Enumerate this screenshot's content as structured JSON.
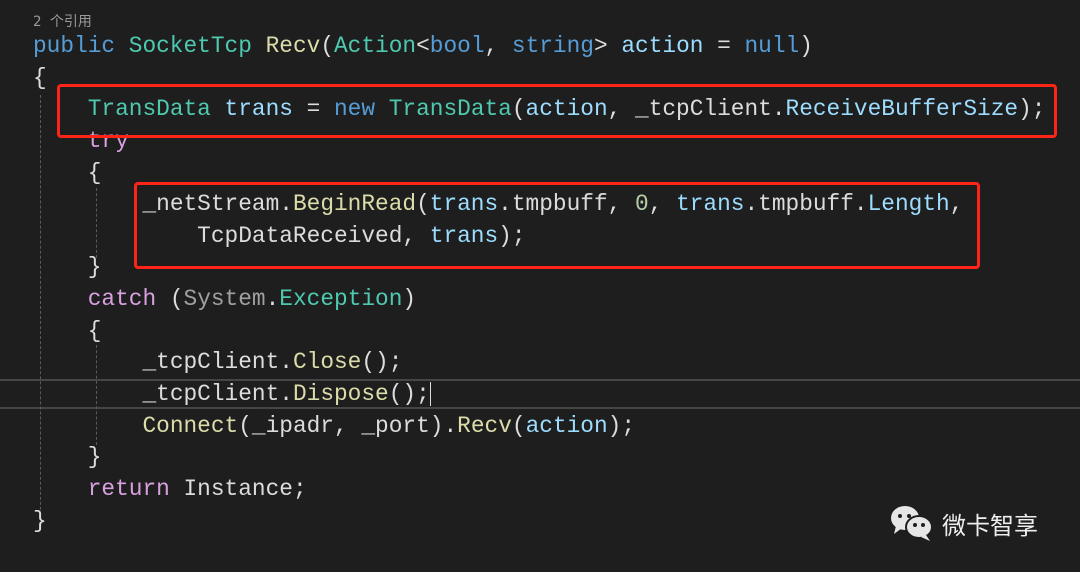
{
  "references": "2 个引用",
  "colors": {
    "kw": "#569cd6",
    "type": "#4ec9b0",
    "method": "#dcdcaa",
    "var": "#9cdcfe",
    "ctrl": "#d8a0df",
    "text": "#dcdcdc",
    "gray": "#a0a0a0",
    "num": "#b5cea8",
    "highlight": "#ff2418"
  },
  "lines": [
    {
      "indent": 0,
      "tokens": [
        [
          "public ",
          "kw"
        ],
        [
          "SocketTcp ",
          "type"
        ],
        [
          "Recv",
          "method"
        ],
        [
          "(",
          "text"
        ],
        [
          "Action",
          "type"
        ],
        [
          "<",
          "text"
        ],
        [
          "bool",
          "kw"
        ],
        [
          ", ",
          "text"
        ],
        [
          "string",
          "kw"
        ],
        [
          "> ",
          "text"
        ],
        [
          "action",
          "var"
        ],
        [
          " = ",
          "text"
        ],
        [
          "null",
          "kw"
        ],
        [
          ")",
          "text"
        ]
      ]
    },
    {
      "indent": 0,
      "tokens": [
        [
          "{",
          "text"
        ]
      ]
    },
    {
      "indent": 4,
      "tokens": [
        [
          "TransData ",
          "type"
        ],
        [
          "trans",
          "var"
        ],
        [
          " = ",
          "text"
        ],
        [
          "new ",
          "kw"
        ],
        [
          "TransData",
          "type"
        ],
        [
          "(",
          "text"
        ],
        [
          "action",
          "var"
        ],
        [
          ", ",
          "text"
        ],
        [
          "_tcpClient",
          "text"
        ],
        [
          ".",
          "text"
        ],
        [
          "ReceiveBufferSize",
          "var"
        ],
        [
          ");",
          "text"
        ]
      ]
    },
    {
      "indent": 4,
      "tokens": [
        [
          "try",
          "ctrl"
        ]
      ]
    },
    {
      "indent": 4,
      "tokens": [
        [
          "{",
          "text"
        ]
      ]
    },
    {
      "indent": 8,
      "tokens": [
        [
          "_netStream",
          "text"
        ],
        [
          ".",
          "text"
        ],
        [
          "BeginRead",
          "method"
        ],
        [
          "(",
          "text"
        ],
        [
          "trans",
          "var"
        ],
        [
          ".",
          "text"
        ],
        [
          "tmpbuff",
          "text"
        ],
        [
          ", ",
          "text"
        ],
        [
          "0",
          "num"
        ],
        [
          ", ",
          "text"
        ],
        [
          "trans",
          "var"
        ],
        [
          ".",
          "text"
        ],
        [
          "tmpbuff",
          "text"
        ],
        [
          ".",
          "text"
        ],
        [
          "Length",
          "var"
        ],
        [
          ",",
          "text"
        ]
      ]
    },
    {
      "indent": 12,
      "tokens": [
        [
          "TcpDataReceived",
          "text"
        ],
        [
          ", ",
          "text"
        ],
        [
          "trans",
          "var"
        ],
        [
          ");",
          "text"
        ]
      ]
    },
    {
      "indent": 4,
      "tokens": [
        [
          "}",
          "text"
        ]
      ]
    },
    {
      "indent": 4,
      "tokens": [
        [
          "catch ",
          "ctrl"
        ],
        [
          "(",
          "text"
        ],
        [
          "System",
          "gray"
        ],
        [
          ".",
          "text"
        ],
        [
          "Exception",
          "type"
        ],
        [
          ")",
          "text"
        ]
      ]
    },
    {
      "indent": 4,
      "tokens": [
        [
          "{",
          "text"
        ]
      ]
    },
    {
      "indent": 8,
      "tokens": [
        [
          "_tcpClient",
          "text"
        ],
        [
          ".",
          "text"
        ],
        [
          "Close",
          "method"
        ],
        [
          "();",
          "text"
        ]
      ]
    },
    {
      "indent": 8,
      "tokens": [
        [
          "_tcpClient",
          "text"
        ],
        [
          ".",
          "text"
        ],
        [
          "Dispose",
          "method"
        ],
        [
          "();",
          "text"
        ]
      ],
      "caret": true
    },
    {
      "indent": 8,
      "tokens": [
        [
          "Connect",
          "method"
        ],
        [
          "(",
          "text"
        ],
        [
          "_ipadr",
          "text"
        ],
        [
          ", ",
          "text"
        ],
        [
          "_port",
          "text"
        ],
        [
          ").",
          "text"
        ],
        [
          "Recv",
          "method"
        ],
        [
          "(",
          "text"
        ],
        [
          "action",
          "var"
        ],
        [
          ");",
          "text"
        ]
      ]
    },
    {
      "indent": 4,
      "tokens": [
        [
          "}",
          "text"
        ]
      ]
    },
    {
      "indent": 4,
      "tokens": [
        [
          "return ",
          "ctrl"
        ],
        [
          "Instance",
          "text"
        ],
        [
          ";",
          "text"
        ]
      ]
    },
    {
      "indent": 0,
      "tokens": [
        [
          "}",
          "text"
        ]
      ]
    }
  ],
  "watermark": {
    "icon": "wechat-icon",
    "text": "微卡智享"
  }
}
